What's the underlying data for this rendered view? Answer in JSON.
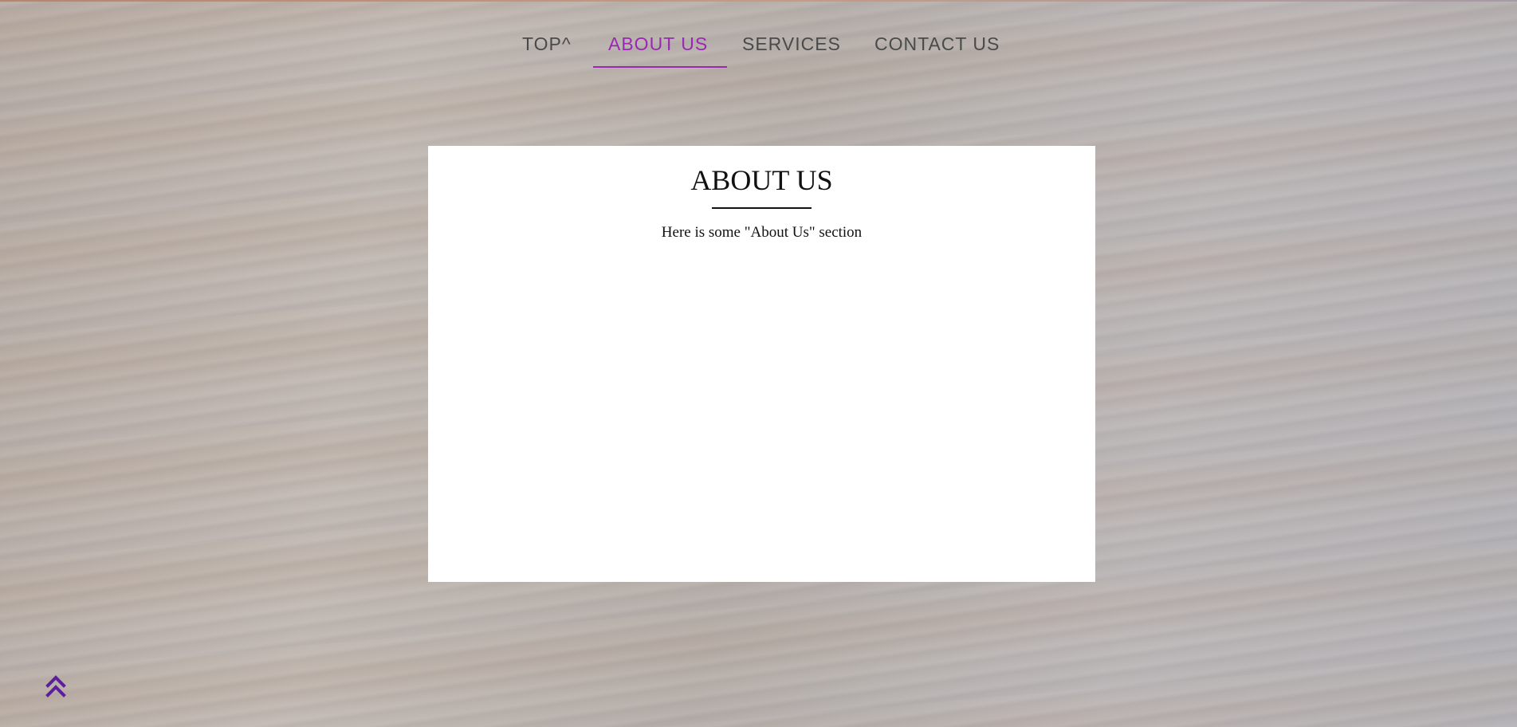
{
  "nav": {
    "items": [
      {
        "label": "TOP^",
        "active": false
      },
      {
        "label": "ABOUT US",
        "active": true
      },
      {
        "label": "SERVICES",
        "active": false
      },
      {
        "label": "CONTACT US",
        "active": false
      }
    ]
  },
  "section": {
    "title": "ABOUT US",
    "body": "Here is some \"About Us\" section"
  },
  "scroll_top": {
    "icon": "double-chevron-up-icon"
  },
  "colors": {
    "accent": "#9b27b5",
    "nav_text": "#4a4a4a",
    "panel_bg": "#ffffff",
    "scroll_icon": "#5b1f9e"
  }
}
